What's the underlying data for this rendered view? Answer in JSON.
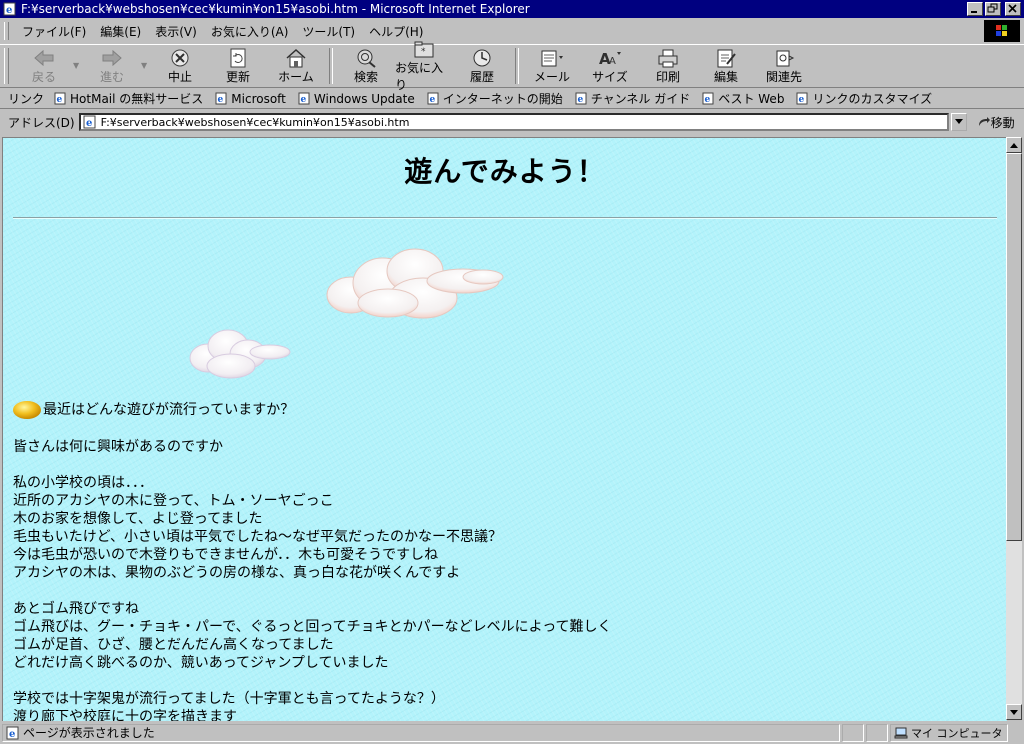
{
  "window": {
    "title": "F:¥serverback¥webshosen¥cec¥kumin¥on15¥asobi.htm - Microsoft Internet Explorer"
  },
  "menu": [
    "ファイル(F)",
    "編集(E)",
    "表示(V)",
    "お気に入り(A)",
    "ツール(T)",
    "ヘルプ(H)"
  ],
  "toolbar": {
    "back": "戻る",
    "forward": "進む",
    "stop": "中止",
    "refresh": "更新",
    "home": "ホーム",
    "search": "検索",
    "favorites": "お気に入り",
    "history": "履歴",
    "mail": "メール",
    "size": "サイズ",
    "print": "印刷",
    "edit": "編集",
    "related": "関連先"
  },
  "links": {
    "label": "リンク",
    "items": [
      "HotMail の無料サービス",
      "Microsoft",
      "Windows Update",
      "インターネットの開始",
      "チャンネル ガイド",
      "ベスト Web",
      "リンクのカスタマイズ"
    ]
  },
  "address": {
    "label": "アドレス(D)",
    "value": "F:¥serverback¥webshosen¥cec¥kumin¥on15¥asobi.htm",
    "go": "移動"
  },
  "page": {
    "title": "遊んでみよう！",
    "lines": [
      "最近はどんな遊びが流行っていますか？",
      "皆さんは何に興味があるのですか",
      "私の小学校の頃は．．．",
      "近所のアカシヤの木に登って、トム・ソーヤごっこ",
      "木のお家を想像して、よじ登ってました",
      "毛虫もいたけど、小さい頃は平気でしたね～なぜ平気だったのかなー不思議？",
      "今は毛虫が恐いので木登りもできませんが．．木も可愛そうですしね",
      "アカシヤの木は、果物のぶどうの房の様な、真っ白な花が咲くんですよ",
      "あとゴム飛びですね",
      "ゴム飛びは、グー・チョキ・パーで、ぐるっと回ってチョキとかパーなどレベルによって難しく",
      "ゴムが足首、ひざ、腰とだんだん高くなってました",
      "どれだけ高く跳べるのか、競いあってジャンプしていました",
      "学校では十字架鬼が流行ってました（十字軍とも言ってたような？）",
      "渡り廊下や校庭に十の字を描きます"
    ]
  },
  "status": {
    "text": "ページが表示されました",
    "zone": "マイ コンピュータ"
  },
  "colors": {
    "titlebar": "#000080",
    "page_background": "#b3f3fb",
    "chrome": "#c0c0c0"
  }
}
